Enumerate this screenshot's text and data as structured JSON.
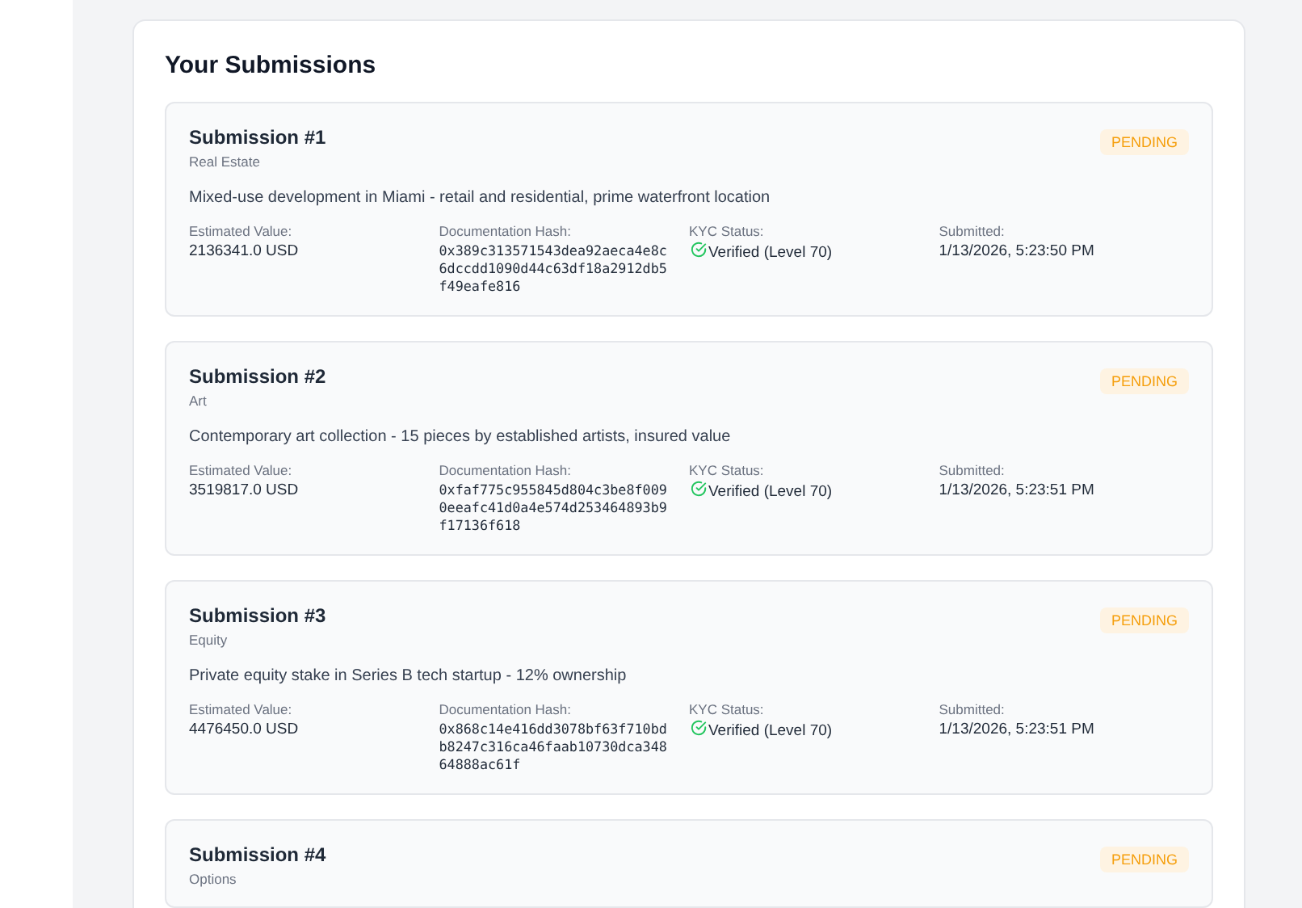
{
  "heading": "Your Submissions",
  "submissions": [
    {
      "title": "Submission #1",
      "category": "Real Estate",
      "status": "PENDING",
      "description": "Mixed-use development in Miami - retail and residential, prime waterfront location",
      "fields": [
        {
          "label": "Estimated Value:",
          "value": "2136341.0 USD",
          "kind": "text"
        },
        {
          "label": "Documentation Hash:",
          "value": "0x389c313571543dea92aeca4e8c6dccdd1090d44c63df18a2912db5f49eafe816",
          "kind": "hash"
        },
        {
          "label": "KYC Status:",
          "value": "Verified (Level 70)",
          "kind": "verified"
        },
        {
          "label": "Submitted:",
          "value": "1/13/2026, 5:23:50 PM",
          "kind": "text"
        }
      ]
    },
    {
      "title": "Submission #2",
      "category": "Art",
      "status": "PENDING",
      "description": "Contemporary art collection - 15 pieces by established artists, insured value",
      "fields": [
        {
          "label": "Estimated Value:",
          "value": "3519817.0 USD",
          "kind": "text"
        },
        {
          "label": "Documentation Hash:",
          "value": "0xfaf775c955845d804c3be8f0090eeafc41d0a4e574d253464893b9f17136f618",
          "kind": "hash"
        },
        {
          "label": "KYC Status:",
          "value": "Verified (Level 70)",
          "kind": "verified"
        },
        {
          "label": "Submitted:",
          "value": "1/13/2026, 5:23:51 PM",
          "kind": "text"
        }
      ]
    },
    {
      "title": "Submission #3",
      "category": "Equity",
      "status": "PENDING",
      "description": "Private equity stake in Series B tech startup - 12% ownership",
      "fields": [
        {
          "label": "Estimated Value:",
          "value": "4476450.0 USD",
          "kind": "text"
        },
        {
          "label": "Documentation Hash:",
          "value": "0x868c14e416dd3078bf63f710bdb8247c316ca46faab10730dca34864888ac61f",
          "kind": "hash"
        },
        {
          "label": "KYC Status:",
          "value": "Verified (Level 70)",
          "kind": "verified"
        },
        {
          "label": "Submitted:",
          "value": "1/13/2026, 5:23:51 PM",
          "kind": "text"
        }
      ]
    },
    {
      "title": "Submission #4",
      "category": "Options",
      "status": "PENDING"
    }
  ]
}
